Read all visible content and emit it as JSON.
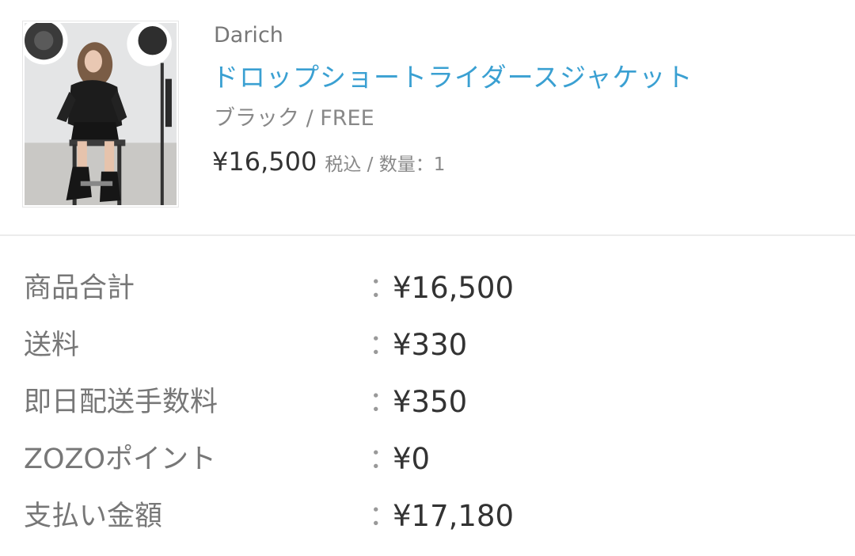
{
  "item": {
    "brand": "Darich",
    "name": "ドロップショートライダースジャケット",
    "variant": "ブラック / FREE",
    "price": "¥16,500",
    "price_meta": "税込 / 数量：1",
    "thumbnail": "product-photo"
  },
  "summary": {
    "rows": [
      {
        "label": "商品合計",
        "colon": "：",
        "value": "¥16,500"
      },
      {
        "label": "送料",
        "colon": "：",
        "value": "¥330"
      },
      {
        "label": "即日配送手数料",
        "colon": "：",
        "value": "¥350"
      },
      {
        "label": "ZOZOポイント",
        "colon": "：",
        "value": "¥0"
      },
      {
        "label": "支払い金額",
        "colon": "：",
        "value": "¥17,180"
      }
    ]
  },
  "colors": {
    "link": "#3aa0d2",
    "text": "#333333",
    "muted": "#777777",
    "divider": "#ececec"
  }
}
